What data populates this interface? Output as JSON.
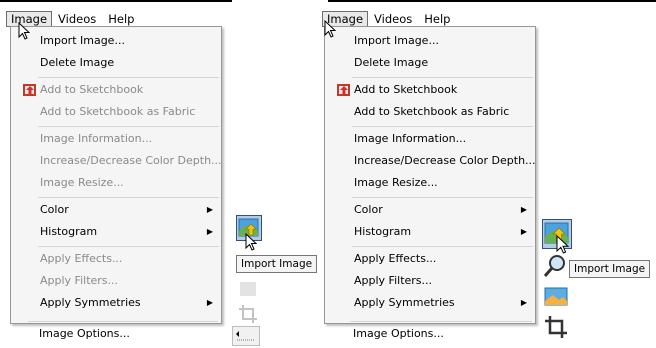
{
  "left": {
    "menubar": [
      "Image",
      "Videos",
      "Help"
    ],
    "menu_items": [
      {
        "label": "Import Image...",
        "disabled": false,
        "submenu": false
      },
      {
        "label": "Delete Image",
        "disabled": false,
        "submenu": false
      },
      {
        "label": "Add to Sketchbook",
        "disabled": true,
        "submenu": false
      },
      {
        "label": "Add to Sketchbook as Fabric",
        "disabled": true,
        "submenu": false
      },
      {
        "label": "Image Information...",
        "disabled": true,
        "submenu": false
      },
      {
        "label": "Increase/Decrease Color Depth...",
        "disabled": true,
        "submenu": false
      },
      {
        "label": "Image Resize...",
        "disabled": true,
        "submenu": false
      },
      {
        "label": "Color",
        "disabled": false,
        "submenu": true
      },
      {
        "label": "Histogram",
        "disabled": false,
        "submenu": true
      },
      {
        "label": "Apply Effects...",
        "disabled": true,
        "submenu": false
      },
      {
        "label": "Apply Filters...",
        "disabled": true,
        "submenu": false
      },
      {
        "label": "Apply Symmetries",
        "disabled": false,
        "submenu": true
      },
      {
        "label": "Image Options...",
        "disabled": false,
        "submenu": false
      }
    ],
    "tooltip": "Import Image"
  },
  "right": {
    "menubar": [
      "Image",
      "Videos",
      "Help"
    ],
    "menu_items": [
      {
        "label": "Import Image...",
        "disabled": false,
        "submenu": false
      },
      {
        "label": "Delete Image",
        "disabled": false,
        "submenu": false
      },
      {
        "label": "Add to Sketchbook",
        "disabled": false,
        "submenu": false
      },
      {
        "label": "Add to Sketchbook as Fabric",
        "disabled": false,
        "submenu": false
      },
      {
        "label": "Image Information...",
        "disabled": false,
        "submenu": false
      },
      {
        "label": "Increase/Decrease Color Depth...",
        "disabled": false,
        "submenu": false
      },
      {
        "label": "Image Resize...",
        "disabled": false,
        "submenu": false
      },
      {
        "label": "Color",
        "disabled": false,
        "submenu": true
      },
      {
        "label": "Histogram",
        "disabled": false,
        "submenu": true
      },
      {
        "label": "Apply Effects...",
        "disabled": false,
        "submenu": false
      },
      {
        "label": "Apply Filters...",
        "disabled": false,
        "submenu": false
      },
      {
        "label": "Apply Symmetries",
        "disabled": false,
        "submenu": true
      },
      {
        "label": "Image Options...",
        "disabled": false,
        "submenu": false
      }
    ],
    "tooltip": "Import Image"
  }
}
